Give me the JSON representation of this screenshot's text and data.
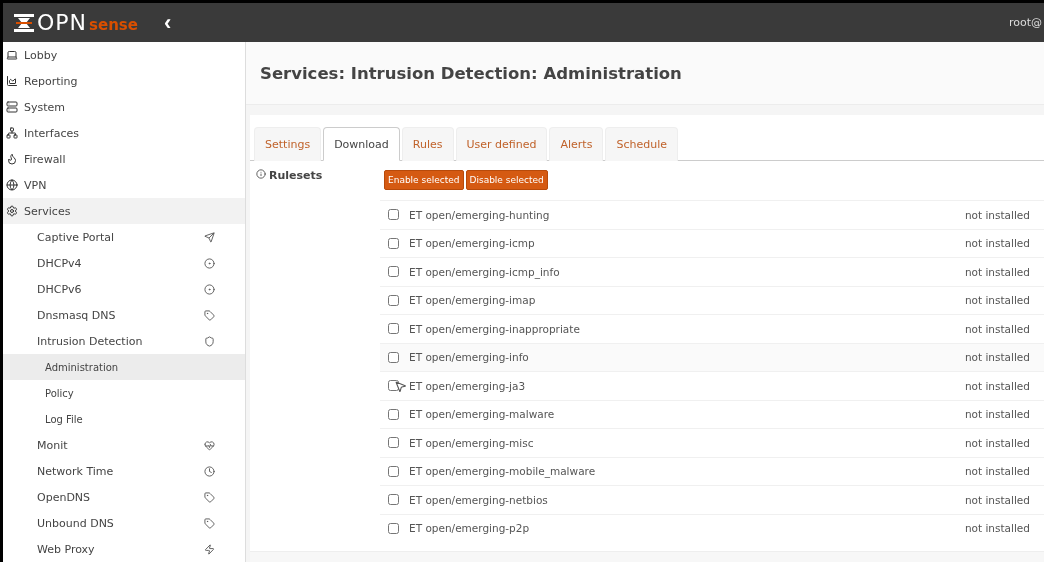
{
  "header": {
    "logo_left": "OPN",
    "logo_right": "sense",
    "collapse": "‹",
    "user": "root@"
  },
  "sidebar": {
    "items": [
      {
        "label": "Lobby",
        "expanded": false
      },
      {
        "label": "Reporting",
        "expanded": false
      },
      {
        "label": "System",
        "expanded": false
      },
      {
        "label": "Interfaces",
        "expanded": false
      },
      {
        "label": "Firewall",
        "expanded": false
      },
      {
        "label": "VPN",
        "expanded": false
      },
      {
        "label": "Services",
        "expanded": true,
        "children": [
          {
            "label": "Captive Portal"
          },
          {
            "label": "DHCPv4"
          },
          {
            "label": "DHCPv6"
          },
          {
            "label": "Dnsmasq DNS"
          },
          {
            "label": "Intrusion Detection",
            "children": [
              {
                "label": "Administration",
                "selected": true
              },
              {
                "label": "Policy",
                "selected": false
              },
              {
                "label": "Log File",
                "selected": false
              }
            ]
          },
          {
            "label": "Monit"
          },
          {
            "label": "Network Time"
          },
          {
            "label": "OpenDNS"
          },
          {
            "label": "Unbound DNS"
          },
          {
            "label": "Web Proxy"
          }
        ]
      }
    ]
  },
  "page": {
    "title": "Services: Intrusion Detection: Administration"
  },
  "tabs": [
    {
      "label": "Settings",
      "selected": false
    },
    {
      "label": "Download",
      "selected": true
    },
    {
      "label": "Rules",
      "selected": false
    },
    {
      "label": "User defined",
      "selected": false
    },
    {
      "label": "Alerts",
      "selected": false
    },
    {
      "label": "Schedule",
      "selected": false
    }
  ],
  "rulesets": {
    "label": "Rulesets",
    "buttons": [
      "Enable selected",
      "Disable selected"
    ],
    "rows": [
      {
        "name": "ET open/emerging-hunting",
        "status": "not installed",
        "checked": false
      },
      {
        "name": "ET open/emerging-icmp",
        "status": "not installed",
        "checked": false
      },
      {
        "name": "ET open/emerging-icmp_info",
        "status": "not installed",
        "checked": false
      },
      {
        "name": "ET open/emerging-imap",
        "status": "not installed",
        "checked": false
      },
      {
        "name": "ET open/emerging-inappropriate",
        "status": "not installed",
        "checked": false
      },
      {
        "name": "ET open/emerging-info",
        "status": "not installed",
        "checked": false
      },
      {
        "name": "ET open/emerging-ja3",
        "status": "not installed",
        "checked": false
      },
      {
        "name": "ET open/emerging-malware",
        "status": "not installed",
        "checked": false
      },
      {
        "name": "ET open/emerging-misc",
        "status": "not installed",
        "checked": false
      },
      {
        "name": "ET open/emerging-mobile_malware",
        "status": "not installed",
        "checked": false
      },
      {
        "name": "ET open/emerging-netbios",
        "status": "not installed",
        "checked": false
      },
      {
        "name": "ET open/emerging-p2p",
        "status": "not installed",
        "checked": false
      }
    ]
  }
}
